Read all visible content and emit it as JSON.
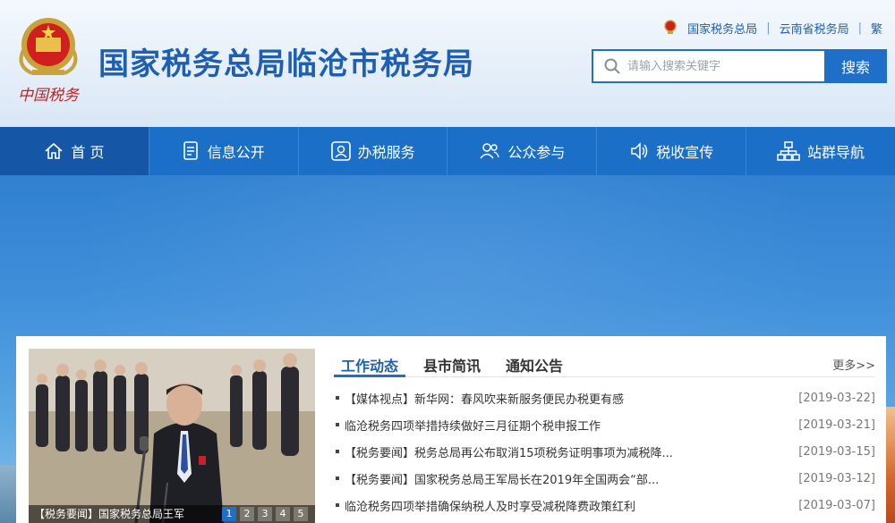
{
  "header": {
    "emblem_text": "中国税务",
    "site_title": "国家税务总局临沧市税务局",
    "toplinks": [
      {
        "label": "国家税务总局"
      },
      {
        "label": "云南省税务局"
      },
      {
        "label": "繁"
      }
    ],
    "search": {
      "placeholder": "请输入搜索关键字",
      "button_label": "搜索"
    }
  },
  "nav": {
    "items": [
      {
        "label": "首 页",
        "icon": "home-icon",
        "active": true
      },
      {
        "label": "信息公开",
        "icon": "document-list-icon"
      },
      {
        "label": "办税服务",
        "icon": "service-icon"
      },
      {
        "label": "公众参与",
        "icon": "people-icon"
      },
      {
        "label": "税收宣传",
        "icon": "speaker-icon"
      },
      {
        "label": "站群导航",
        "icon": "sitemap-icon"
      }
    ]
  },
  "news_panel": {
    "photo": {
      "caption": "【税务要闻】国家税务总局王军",
      "pages": [
        "1",
        "2",
        "3",
        "4",
        "5"
      ]
    },
    "tabs": [
      {
        "label": "工作动态",
        "active": true
      },
      {
        "label": "县市简讯"
      },
      {
        "label": "通知公告"
      }
    ],
    "more_label": "更多>>",
    "items": [
      {
        "title": "【媒体视点】新华网：春风吹来新服务便民办税更有感",
        "date": "[2019-03-22]"
      },
      {
        "title": "临沧税务四项举措持续做好三月征期个税申报工作",
        "date": "[2019-03-21]"
      },
      {
        "title": "【税务要闻】税务总局再公布取消15项税务证明事项为减税降...",
        "date": "[2019-03-15]"
      },
      {
        "title": "【税务要闻】国家税务总局王军局长在2019年全国两会“部...",
        "date": "[2019-03-12]"
      },
      {
        "title": "临沧税务四项举措确保纳税人及时享受减税降费政策红利",
        "date": "[2019-03-07]"
      }
    ]
  },
  "colors": {
    "brand_blue": "#1f5fb2",
    "nav_blue": "#1c6fc6",
    "nav_active": "#1557a6"
  }
}
